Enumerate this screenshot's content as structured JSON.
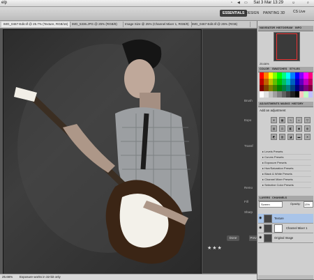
{
  "menubar": {
    "app": "elp",
    "clock": "Sat 3 Mar  13:29"
  },
  "optbar": {
    "workspaces": [
      "ESSENTIALS",
      "DESIGN",
      "PAINTING",
      "3D"
    ],
    "cs_live": "CS Live"
  },
  "tabs": [
    "IMG_0467-Edit.tif @ 25.7% (Texture, RGB/16)",
    "IMG_5336.JPG @ 25% (RGB/8)",
    "Image Size @ 25% (Channel Mixer 1, RGB/8)",
    "IMG_0467-Edit.tif @ 25% (RGB)"
  ],
  "status": {
    "zoom": "25.66%",
    "message": "Exposure works in 32-bit only"
  },
  "background_app": {
    "stars": "★★★",
    "done": "Done",
    "prev": "Prev",
    "labels": [
      "Brush",
      "Expo",
      "Transf",
      "Remo",
      "Fill",
      "Sharp"
    ]
  },
  "navigator": {
    "tabs": [
      "NAVIGATOR",
      "HISTOGRAM",
      "INFO"
    ],
    "zoom": "25.66%"
  },
  "color_panel": {
    "tabs": [
      "COLOR",
      "SWATCHES",
      "STYLES"
    ]
  },
  "swatches": [
    "#ff0000",
    "#ff8000",
    "#ffff00",
    "#80ff00",
    "#00ff00",
    "#00ff80",
    "#00ffff",
    "#0080ff",
    "#0000ff",
    "#8000ff",
    "#ff00ff",
    "#ff0080",
    "#c00000",
    "#c06000",
    "#c0c000",
    "#60c000",
    "#00c000",
    "#00c060",
    "#00c0c0",
    "#0060c0",
    "#0000c0",
    "#6000c0",
    "#c000c0",
    "#c00060",
    "#800000",
    "#804000",
    "#808000",
    "#408000",
    "#008000",
    "#008040",
    "#008080",
    "#004080",
    "#000080",
    "#400080",
    "#800080",
    "#800040",
    "#ffffff",
    "#e0e0e0",
    "#c0c0c0",
    "#a0a0a0",
    "#808080",
    "#606060",
    "#404040",
    "#202020",
    "#000000",
    "#ffc0c0",
    "#c0ffc0",
    "#c0c0ff"
  ],
  "adjustments": {
    "tabs": [
      "ADJUSTMENTS",
      "MASKS",
      "HISTORY"
    ],
    "title": "Add an adjustment",
    "presets": [
      "Levels Presets",
      "Curves Presets",
      "Exposure Presets",
      "Hue/Saturation Presets",
      "Black & White Presets",
      "Channel Mixer Presets",
      "Selective Color Presets"
    ]
  },
  "layers": {
    "tabs": [
      "LAYERS",
      "CHANNELS"
    ],
    "blend_mode": "Screen",
    "opacity_label": "Opacity:",
    "opacity": "13%",
    "items": [
      "Texture",
      "Channel Mixer 1",
      "Original Image"
    ]
  }
}
